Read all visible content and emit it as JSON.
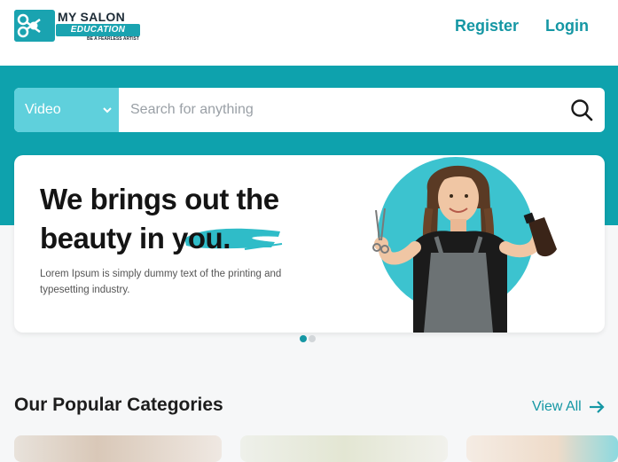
{
  "header": {
    "logo_title": "MY SALON",
    "logo_sub": "EDUCATION",
    "logo_tag": "BE A FEARLESS ARTIST",
    "register": "Register",
    "login": "Login"
  },
  "search": {
    "type_selected": "Video",
    "placeholder": "Search for anything"
  },
  "banner": {
    "headline_line1": "We brings out the",
    "headline_line2": "beauty in you.",
    "description": "Lorem Ipsum is simply dummy text of the printing and typesetting industry.",
    "active_slide": 1,
    "slide_count": 2
  },
  "categories": {
    "title": "Our Popular Categories",
    "view_all": "View All"
  },
  "colors": {
    "brand": "#1597a4",
    "band": "#0ea2ad",
    "select": "#5fd0dc"
  }
}
